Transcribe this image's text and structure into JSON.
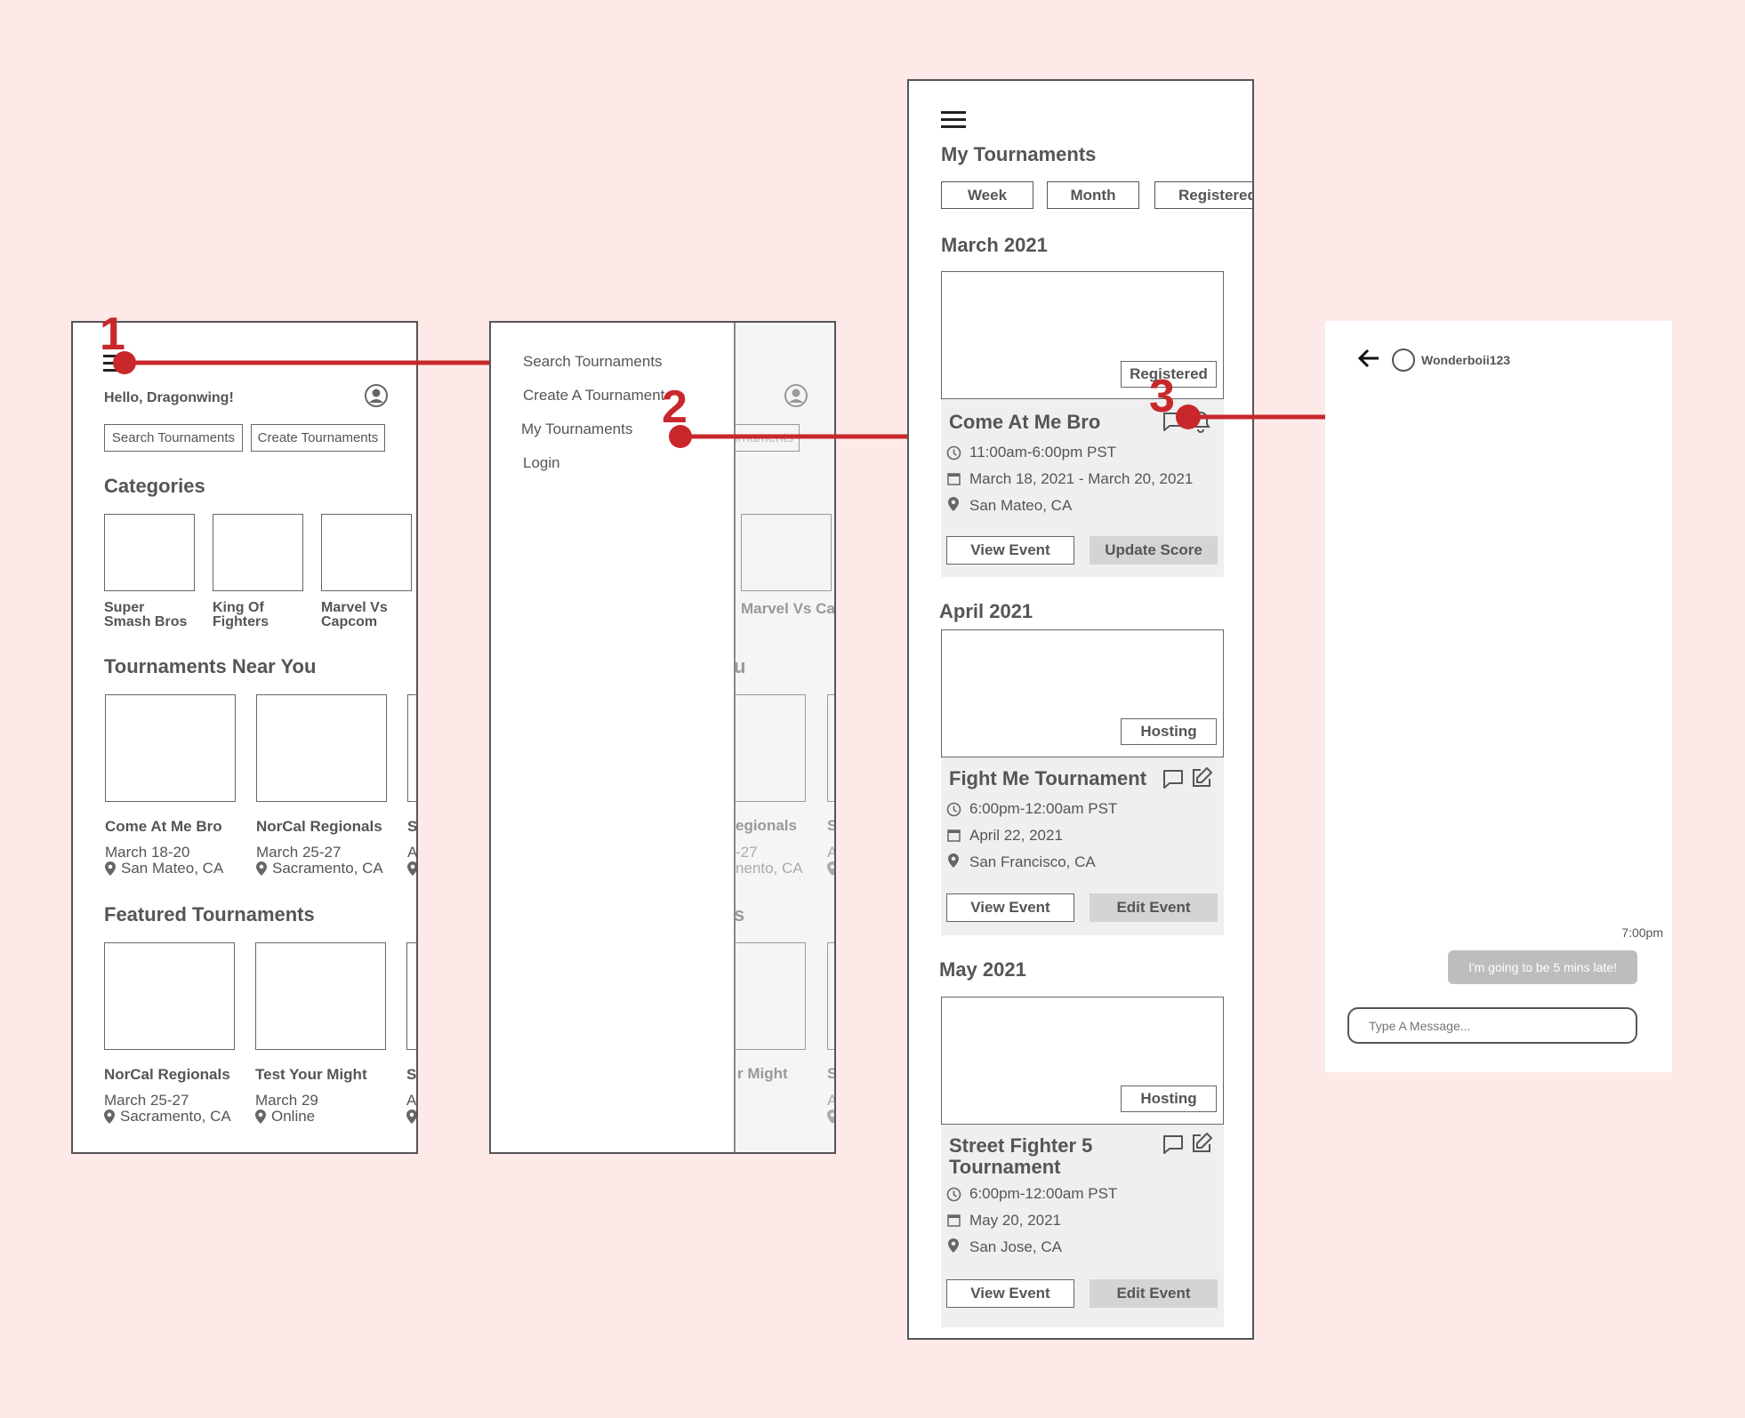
{
  "colors": {
    "background": "#fde9e8",
    "annotation": "#c8282b",
    "card": "#efefef",
    "button_gray": "#d4d4d4"
  },
  "steps": [
    "1",
    "2",
    "3"
  ],
  "home": {
    "greeting": "Hello, Dragonwing!",
    "search_button": "Search Tournaments",
    "create_button": "Create Tournaments",
    "categories_heading": "Categories",
    "categories": [
      "Super Smash Bros",
      "King Of Fighters",
      "Marvel Vs Capcom"
    ],
    "near_heading": "Tournaments Near You",
    "near": [
      {
        "title": "Come At Me Bro",
        "date": "March 18-20",
        "location": "San Mateo, CA"
      },
      {
        "title": "NorCal Regionals",
        "date": "March 25-27",
        "location": "Sacramento, CA"
      },
      {
        "title": "S",
        "date": "A",
        "location": ""
      }
    ],
    "featured_heading": "Featured Tournaments",
    "featured": [
      {
        "title": "NorCal Regionals",
        "date": "March 25-27",
        "location": "Sacramento, CA"
      },
      {
        "title": "Test Your Might",
        "date": "March 29",
        "location": "Online"
      },
      {
        "title": "S",
        "date": "A",
        "location": ""
      }
    ]
  },
  "menu": {
    "items": [
      "Search Tournaments",
      "Create A Tournament",
      "My Tournaments",
      "Login"
    ],
    "ghost": {
      "cat": "Marvel Vs Capcom",
      "near_heading_tail": "u",
      "featured_heading_tail": "s",
      "near": [
        {
          "title": "egionals",
          "date": "-27",
          "location": "nento, CA"
        },
        {
          "title": "S",
          "date": "A"
        }
      ],
      "featured": [
        {
          "title": "r Might"
        },
        {
          "title": "S",
          "date": "A"
        }
      ],
      "button_tail": "ournaments"
    }
  },
  "my": {
    "title": "My Tournaments",
    "filters": [
      "Week",
      "Month",
      "Registered"
    ],
    "months": [
      {
        "label": "March 2021",
        "badge": "Registered",
        "title": "Come At Me Bro",
        "time": "11:00am-6:00pm PST",
        "date": "March 18, 2021 - March 20, 2021",
        "location": "San Mateo, CA",
        "btn1": "View Event",
        "btn2": "Update Score"
      },
      {
        "label": "April 2021",
        "badge": "Hosting",
        "title": "Fight Me Tournament",
        "time": "6:00pm-12:00am PST",
        "date": "April 22, 2021",
        "location": "San Francisco, CA",
        "btn1": "View Event",
        "btn2": "Edit Event"
      },
      {
        "label": "May 2021",
        "badge": "Hosting",
        "title": "Street Fighter 5 Tournament",
        "time": "6:00pm-12:00am PST",
        "date": "May 20, 2021",
        "location": "San Jose, CA",
        "btn1": "View Event",
        "btn2": "Edit Event"
      }
    ]
  },
  "chat": {
    "username": "Wonderboii123",
    "timestamp": "7:00pm",
    "message": "I'm going to be 5 mins late!",
    "input_placeholder": "Type A Message..."
  }
}
